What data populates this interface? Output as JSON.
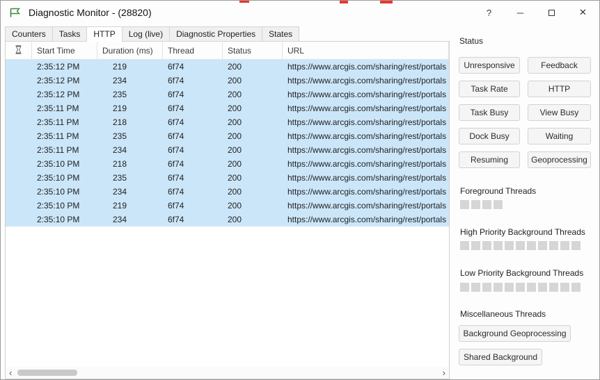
{
  "window": {
    "title": "Diagnostic Monitor - (28820)",
    "controls": {
      "help": "?",
      "minimize": "─",
      "close": "✕"
    }
  },
  "tabs": [
    {
      "label": "Counters",
      "active": false
    },
    {
      "label": "Tasks",
      "active": false
    },
    {
      "label": "HTTP",
      "active": true
    },
    {
      "label": "Log (live)",
      "active": false
    },
    {
      "label": "Diagnostic Properties",
      "active": false
    },
    {
      "label": "States",
      "active": false
    }
  ],
  "table": {
    "columns": [
      "Start Time",
      "Duration (ms)",
      "Thread",
      "Status",
      "URL"
    ],
    "scrollbar": {
      "left": "‹",
      "right": "›"
    },
    "rows": [
      {
        "start_time": "2:35:12 PM",
        "duration": "219",
        "thread": "6f74",
        "status": "200",
        "url": "https://www.arcgis.com/sharing/rest/portals"
      },
      {
        "start_time": "2:35:12 PM",
        "duration": "234",
        "thread": "6f74",
        "status": "200",
        "url": "https://www.arcgis.com/sharing/rest/portals"
      },
      {
        "start_time": "2:35:12 PM",
        "duration": "235",
        "thread": "6f74",
        "status": "200",
        "url": "https://www.arcgis.com/sharing/rest/portals"
      },
      {
        "start_time": "2:35:11 PM",
        "duration": "219",
        "thread": "6f74",
        "status": "200",
        "url": "https://www.arcgis.com/sharing/rest/portals"
      },
      {
        "start_time": "2:35:11 PM",
        "duration": "218",
        "thread": "6f74",
        "status": "200",
        "url": "https://www.arcgis.com/sharing/rest/portals"
      },
      {
        "start_time": "2:35:11 PM",
        "duration": "235",
        "thread": "6f74",
        "status": "200",
        "url": "https://www.arcgis.com/sharing/rest/portals"
      },
      {
        "start_time": "2:35:11 PM",
        "duration": "234",
        "thread": "6f74",
        "status": "200",
        "url": "https://www.arcgis.com/sharing/rest/portals"
      },
      {
        "start_time": "2:35:10 PM",
        "duration": "218",
        "thread": "6f74",
        "status": "200",
        "url": "https://www.arcgis.com/sharing/rest/portals"
      },
      {
        "start_time": "2:35:10 PM",
        "duration": "235",
        "thread": "6f74",
        "status": "200",
        "url": "https://www.arcgis.com/sharing/rest/portals"
      },
      {
        "start_time": "2:35:10 PM",
        "duration": "234",
        "thread": "6f74",
        "status": "200",
        "url": "https://www.arcgis.com/sharing/rest/portals"
      },
      {
        "start_time": "2:35:10 PM",
        "duration": "219",
        "thread": "6f74",
        "status": "200",
        "url": "https://www.arcgis.com/sharing/rest/portals"
      },
      {
        "start_time": "2:35:10 PM",
        "duration": "234",
        "thread": "6f74",
        "status": "200",
        "url": "https://www.arcgis.com/sharing/rest/portals"
      }
    ]
  },
  "status_panel": {
    "title": "Status",
    "buttons": [
      "Unresponsive",
      "Feedback",
      "Task Rate",
      "HTTP",
      "Task Busy",
      "View Busy",
      "Dock Busy",
      "Waiting",
      "Resuming",
      "Geoprocessing"
    ]
  },
  "threads": {
    "foreground": {
      "label": "Foreground Threads",
      "count": 4
    },
    "high": {
      "label": "High Priority Background Threads",
      "count": 11
    },
    "low": {
      "label": "Low Priority Background Threads",
      "count": 11
    },
    "misc": {
      "label": "Miscellaneous Threads",
      "buttons": [
        "Background Geoprocessing",
        "Shared Background"
      ]
    }
  },
  "colors": {
    "selection_blue": "#cbe6f9",
    "app_icon_green": "#3c8b40",
    "artifact_red": "#e8372c"
  }
}
